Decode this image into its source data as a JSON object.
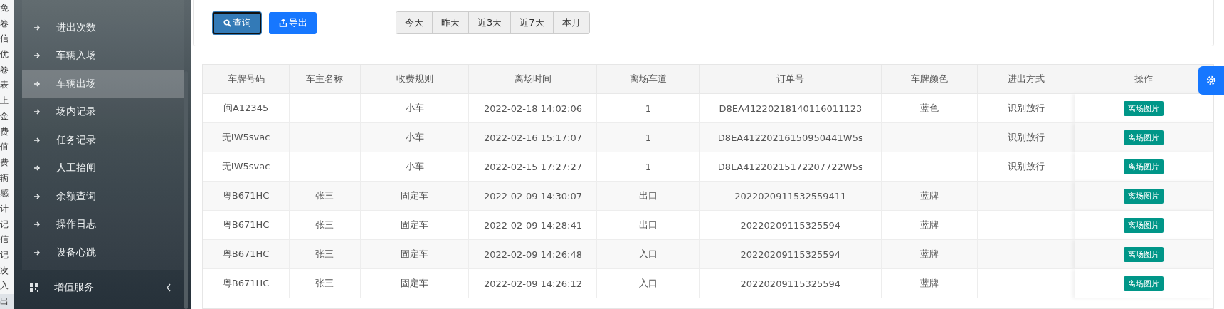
{
  "left_strip": [
    "免",
    "卷",
    "信",
    "优",
    "卷",
    "表",
    "上",
    "金",
    "费",
    "值",
    "费",
    "辆",
    "感",
    "计",
    "记",
    "信",
    "记",
    "次",
    "入",
    "出"
  ],
  "sidebar": {
    "items": [
      {
        "label": "进出次数",
        "selected": false
      },
      {
        "label": "车辆入场",
        "selected": false
      },
      {
        "label": "车辆出场",
        "selected": true
      },
      {
        "label": "场内记录",
        "selected": false
      },
      {
        "label": "任务记录",
        "selected": false
      },
      {
        "label": "人工抬闸",
        "selected": false
      },
      {
        "label": "余额查询",
        "selected": false
      },
      {
        "label": "操作日志",
        "selected": false
      },
      {
        "label": "设备心跳",
        "selected": false
      }
    ],
    "group": {
      "label": "增值服务",
      "expanded": false
    }
  },
  "toolbar": {
    "buttons": [
      {
        "kind": "query",
        "label": "查询"
      },
      {
        "kind": "export",
        "label": "导出"
      }
    ],
    "date_range": [
      "今天",
      "昨天",
      "近3天",
      "近7天",
      "本月"
    ]
  },
  "table": {
    "columns": [
      "车牌号码",
      "车主名称",
      "收费规则",
      "离场时间",
      "离场车道",
      "订单号",
      "车牌颜色",
      "进出方式",
      "操作"
    ],
    "rows": [
      {
        "cells": [
          "闽A12345",
          "",
          "小车",
          "2022-02-18 14:02:06",
          "1",
          "D8EA41220218140116011123",
          "蓝色",
          "识别放行"
        ],
        "action": "离场图片"
      },
      {
        "cells": [
          "无IW5svac",
          "",
          "小车",
          "2022-02-16 15:17:07",
          "1",
          "D8EA41220216150950441W5s",
          "",
          "识别放行"
        ],
        "action": "离场图片"
      },
      {
        "cells": [
          "无IW5svac",
          "",
          "小车",
          "2022-02-15 17:27:27",
          "1",
          "D8EA41220215172207722W5s",
          "",
          "识别放行"
        ],
        "action": "离场图片"
      },
      {
        "cells": [
          "粤B671HC",
          "张三",
          "固定车",
          "2022-02-09 14:30:07",
          "出口",
          "2022020911532559411",
          "蓝牌",
          ""
        ],
        "action": "离场图片"
      },
      {
        "cells": [
          "粤B671HC",
          "张三",
          "固定车",
          "2022-02-09 14:28:41",
          "出口",
          "20220209115325594",
          "蓝牌",
          ""
        ],
        "action": "离场图片"
      },
      {
        "cells": [
          "粤B671HC",
          "张三",
          "固定车",
          "2022-02-09 14:26:48",
          "入口",
          "20220209115325594",
          "蓝牌",
          ""
        ],
        "action": "离场图片"
      },
      {
        "cells": [
          "粤B671HC",
          "张三",
          "固定车",
          "2022-02-09 14:26:12",
          "入口",
          "20220209115325594",
          "蓝牌",
          ""
        ],
        "action": "离场图片"
      }
    ]
  }
}
